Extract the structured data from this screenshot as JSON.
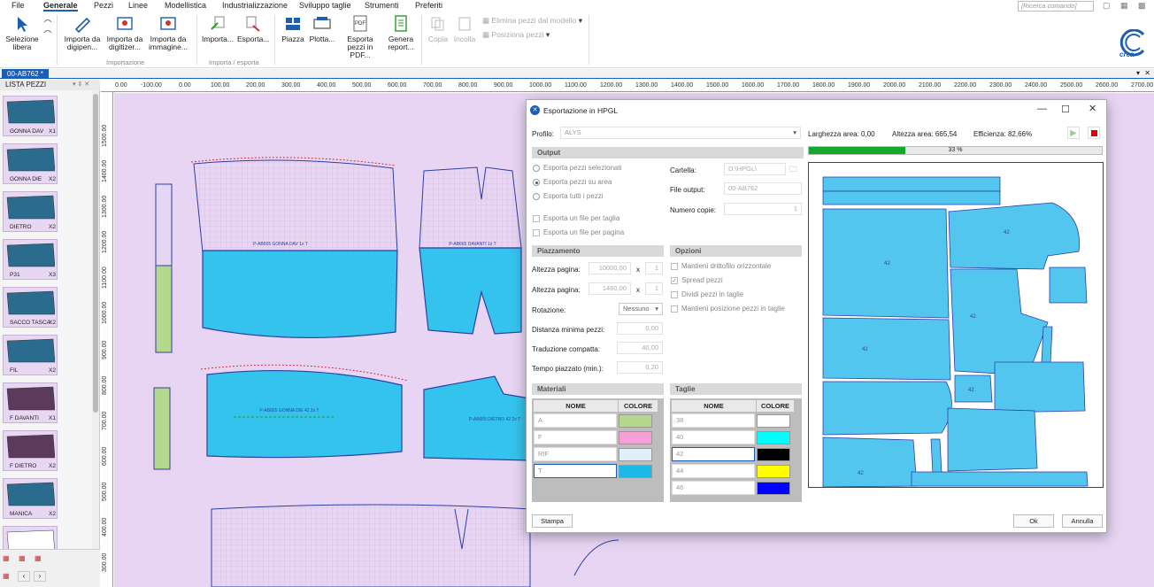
{
  "menu": {
    "items": [
      "File",
      "Generale",
      "Pezzi",
      "Linee",
      "Modellistica",
      "Industrializzazione",
      "Sviluppo taglie",
      "Strumenti",
      "Preferiti"
    ],
    "search_placeholder": "[Ricerca comando]"
  },
  "ribbon": {
    "selezione": "Selezione libera",
    "importa_digipen": "Importa da digipen...",
    "importa_digitizer": "Importa da digitizer...",
    "importa_immagine": "Importa da immagine...",
    "group_importazione": "Importazione",
    "importa": "Importa...",
    "esporta": "Esporta...",
    "group_importa_esporta": "Importa / esporta",
    "piazza": "Piazza",
    "plotta": "Plotta...",
    "esporta_pdf": "Esporta pezzi in PDF...",
    "genera_report": "Genera report...",
    "copia": "Copia",
    "incolla": "Incolla",
    "elimina": "Elimina pezzi dal modello",
    "posiziona": "Posiziona pezzi",
    "pdf_tag": "PDF",
    "logo_text": "crea"
  },
  "doc_tab": "00-AB762 *",
  "left_panel": {
    "title": "LISTA PEZZI",
    "pieces": [
      {
        "name": "GONNA DAV",
        "qty": "X1",
        "color": "#2a6b8e"
      },
      {
        "name": "GONNA DIE",
        "qty": "X2",
        "color": "#2a6b8e"
      },
      {
        "name": "DIETRO",
        "qty": "X2",
        "color": "#2a6b8e"
      },
      {
        "name": "P31",
        "qty": "X3",
        "color": "#2a6b8e"
      },
      {
        "name": "SACCO TASCA",
        "qty": "X2",
        "color": "#2a6b8e"
      },
      {
        "name": "FIL",
        "qty": "X2",
        "color": "#2a6b8e"
      },
      {
        "name": "F DAVANTI",
        "qty": "X1",
        "color": "#5b3a5c"
      },
      {
        "name": "F DIETRO",
        "qty": "X2",
        "color": "#5b3a5c"
      },
      {
        "name": "MANICA",
        "qty": "X2",
        "color": "#2a6b8e"
      },
      {
        "name": "",
        "qty": "",
        "color": "#ffffff"
      }
    ]
  },
  "ruler_top": [
    "0.00",
    "-100.00",
    "0.00",
    "100.00",
    "200.00",
    "300.00",
    "400.00",
    "500.00",
    "600.00",
    "700.00",
    "800.00",
    "900.00",
    "1000.00",
    "1100.00",
    "1200.00",
    "1300.00",
    "1400.00",
    "1500.00",
    "1600.00",
    "1700.00",
    "1800.00",
    "1900.00",
    "2000.00",
    "2100.00",
    "2200.00",
    "2300.00",
    "2400.00",
    "2500.00",
    "2600.00",
    "2700.00"
  ],
  "ruler_left": [
    "1500.00",
    "1400.00",
    "1300.00",
    "1200.00",
    "1100.00",
    "1000.00",
    "900.00",
    "800.00",
    "700.00",
    "600.00",
    "500.00",
    "400.00",
    "300.00"
  ],
  "canvas_labels": {
    "gonna_dav": "P-AB665 GONNA DAV 1x T",
    "davanti": "P-AB665 DAVANTI 1x T",
    "gonna_die": "P-AB665 GONNA DIE 42 2x T",
    "dietro": "P-AB665 DIETRO 42 2x T"
  },
  "dialog": {
    "title": "Esportazione in HPGL",
    "profilo_label": "Profilo:",
    "profilo_value": "ALYS",
    "larghezza": "Larghezza area: 0,00",
    "altezza_area": "Altezza area: 665,54",
    "efficienza": "Efficienza: 82,66%",
    "progress_text": "33 %",
    "progress": 0.33,
    "output_header": "Output",
    "radio_selezionati": "Esporta pezzi selezionati",
    "radio_area": "Esporta pezzi su area",
    "radio_tutti": "Esporta tutti i pezzi",
    "chk_file_taglia": "Esporta un file per taglia",
    "chk_file_pagina": "Esporta un file per pagina",
    "cartella_label": "Cartella:",
    "cartella_value": "D:\\HPGL\\",
    "file_output_label": "File output:",
    "file_output_value": "00-AB762",
    "copie_label": "Numero copie:",
    "copie_value": "1",
    "piazzamento_header": "Piazzamento",
    "altezza_pagina_label": "Altezza pagina:",
    "altezza_pagina_1": "10000,00",
    "altezza_pagina_2": "1460,00",
    "x_sep": "x",
    "mult_1": "1",
    "mult_2": "1",
    "rotazione_label": "Rotazione:",
    "rotazione_value": "Nessuno",
    "distanza_label": "Distanza minima pezzi:",
    "distanza_value": "0,00",
    "traduzione_label": "Traduzione compatta:",
    "traduzione_value": "40,00",
    "tempo_label": "Tempo piazzato (min.):",
    "tempo_value": "0,20",
    "opzioni_header": "Opzioni",
    "opt_drittofilo": "Mantieni drittofilo orizzontale",
    "opt_spread": "Spread pezzi",
    "opt_dividi": "Dividi pezzi in taglie",
    "opt_posizione": "Mantieni posizione pezzi in taglie",
    "materiali_header": "Materiali",
    "taglie_header": "Taglie",
    "col_nome": "NOME",
    "col_colore": "COLORE",
    "materiali": [
      {
        "name": "A",
        "color": "#b5d98c"
      },
      {
        "name": "F",
        "color": "#f59fd6"
      },
      {
        "name": "RIF",
        "color": "#dff0f8"
      },
      {
        "name": "T",
        "color": "#1eb8e8"
      }
    ],
    "taglie": [
      {
        "name": "38",
        "color": "#ffffff"
      },
      {
        "name": "40",
        "color": "#00ffff"
      },
      {
        "name": "42",
        "color": "#000000"
      },
      {
        "name": "44",
        "color": "#ffff00"
      },
      {
        "name": "46",
        "color": "#0000ff"
      }
    ],
    "btn_stampa": "Stampa",
    "btn_ok": "Ok",
    "btn_annulla": "Annulla",
    "preview_label": "42"
  }
}
